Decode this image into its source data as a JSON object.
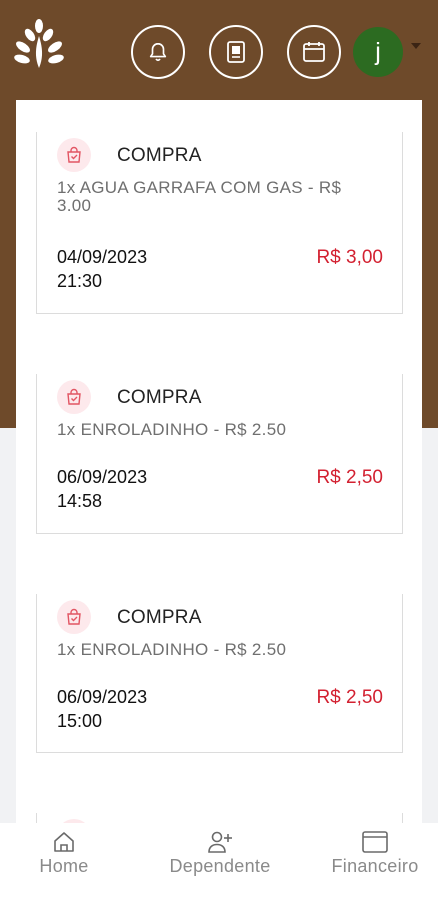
{
  "header": {
    "icons": [
      "notification-bell-icon",
      "photo-card-icon",
      "calendar-icon"
    ],
    "avatar_initial": "j"
  },
  "transactions": [
    {
      "type": "COMPRA",
      "description": "1x AGUA GARRAFA COM GAS - R$ 3.00",
      "date": "04/09/2023",
      "time": "21:30",
      "amount": "R$ 3,00"
    },
    {
      "type": "COMPRA",
      "description": "1x ENROLADINHO - R$ 2.50",
      "date": "06/09/2023",
      "time": "14:58",
      "amount": "R$ 2,50"
    },
    {
      "type": "COMPRA",
      "description": "1x ENROLADINHO - R$ 2.50",
      "date": "06/09/2023",
      "time": "15:00",
      "amount": "R$ 2,50"
    }
  ],
  "bottom_nav": {
    "items": [
      {
        "label": "Home",
        "icon": "home-icon"
      },
      {
        "label": "Dependente",
        "icon": "add-user-icon"
      },
      {
        "label": "Financeiro",
        "icon": "wallet-icon"
      }
    ]
  },
  "colors": {
    "header_brown": "#6e4a2a",
    "amount_red": "#d32131",
    "avatar_green": "#2c6b21"
  }
}
